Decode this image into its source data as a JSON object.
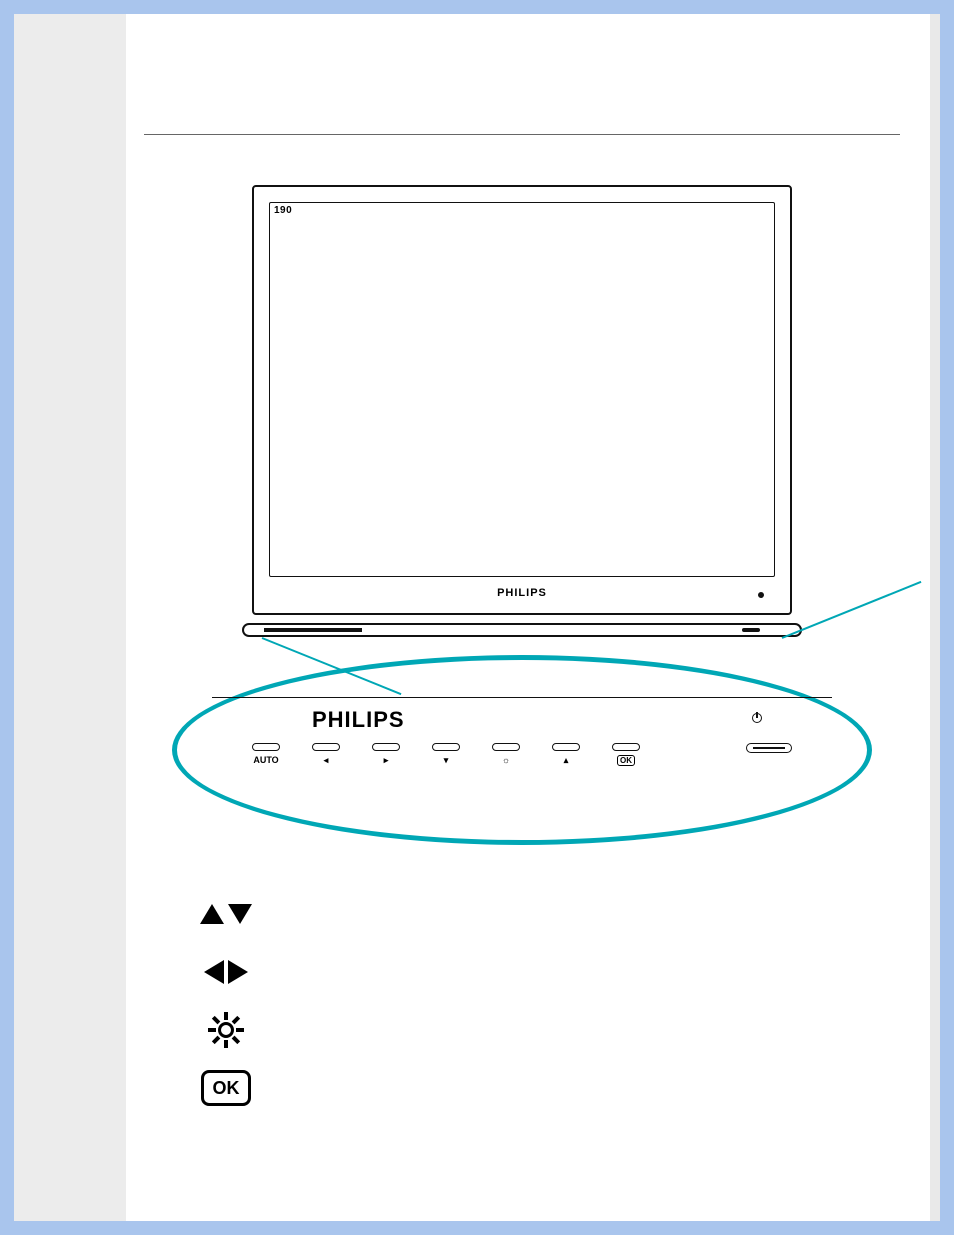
{
  "monitor": {
    "model_badge": "190",
    "brand": "PHILIPS"
  },
  "zoom_panel": {
    "brand": "PHILIPS",
    "buttons": [
      {
        "id": "auto",
        "label": "AUTO",
        "glyph": ""
      },
      {
        "id": "left",
        "label": "◂",
        "glyph": ""
      },
      {
        "id": "right",
        "label": "▸",
        "glyph": ""
      },
      {
        "id": "down",
        "label": "▾",
        "glyph": ""
      },
      {
        "id": "brightness",
        "label": "☼",
        "glyph": ""
      },
      {
        "id": "up",
        "label": "▴",
        "glyph": ""
      },
      {
        "id": "ok",
        "label": "OK",
        "glyph": ""
      }
    ]
  },
  "legend": {
    "rows": [
      {
        "id": "up-down",
        "icon": "up-down"
      },
      {
        "id": "left-right",
        "icon": "left-right"
      },
      {
        "id": "brightness",
        "icon": "sun"
      },
      {
        "id": "ok",
        "icon": "ok",
        "label": "OK"
      }
    ]
  }
}
